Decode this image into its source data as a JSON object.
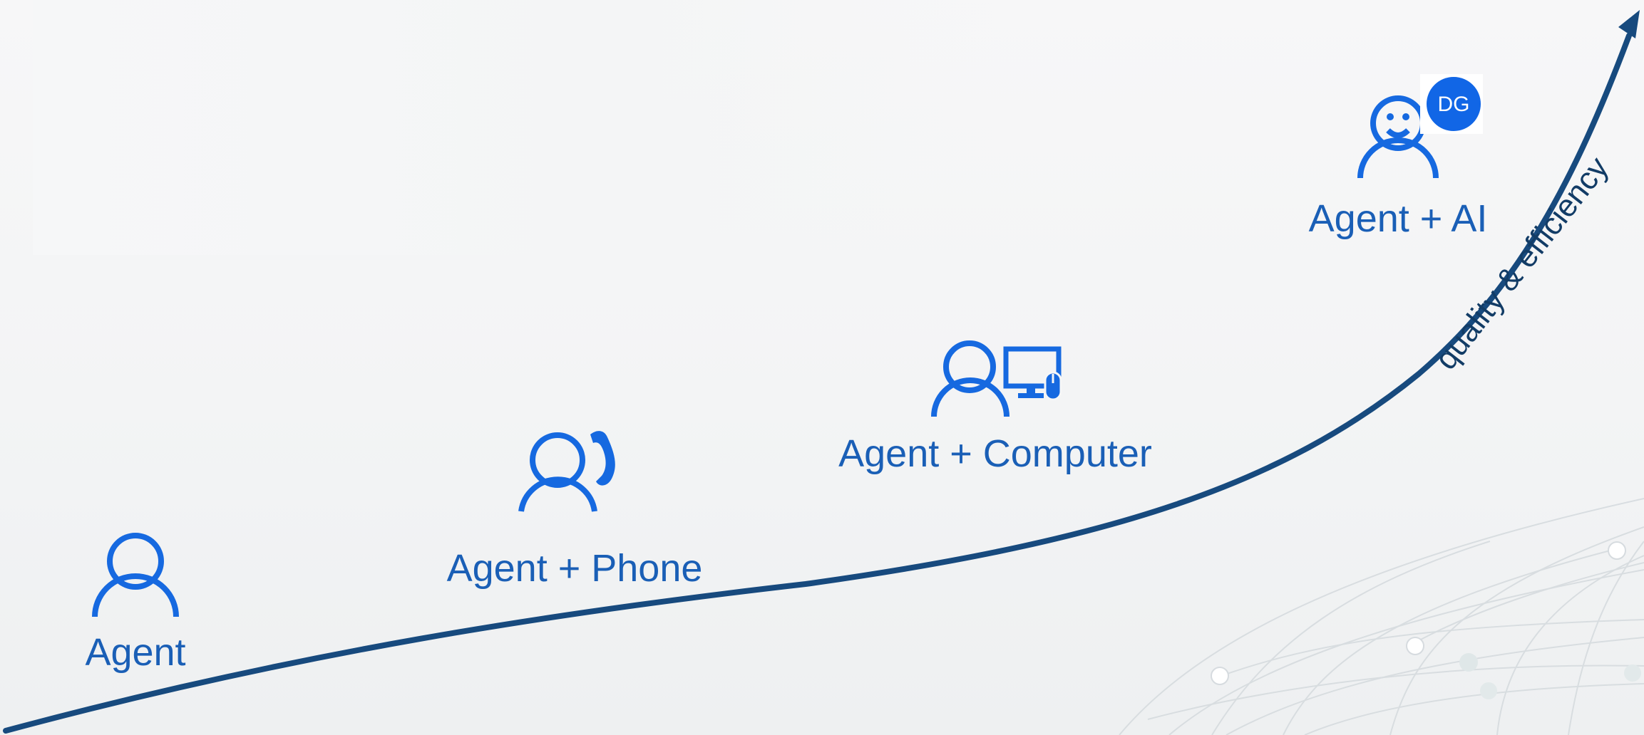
{
  "stages": [
    {
      "label": "Agent",
      "icon": "person-icon"
    },
    {
      "label": "Agent + Phone",
      "icon": "person-phone-icon"
    },
    {
      "label": "Agent + Computer",
      "icon": "person-computer-icon"
    },
    {
      "label": "Agent + AI",
      "icon": "person-smile-ai-icon"
    }
  ],
  "ai_badge": "DG",
  "axis_label": "quality & efficiency",
  "colors": {
    "icon_blue": "#1669e0",
    "label_blue": "#1a5fb6",
    "curve": "#174a7e",
    "badge": "#1166e6"
  }
}
